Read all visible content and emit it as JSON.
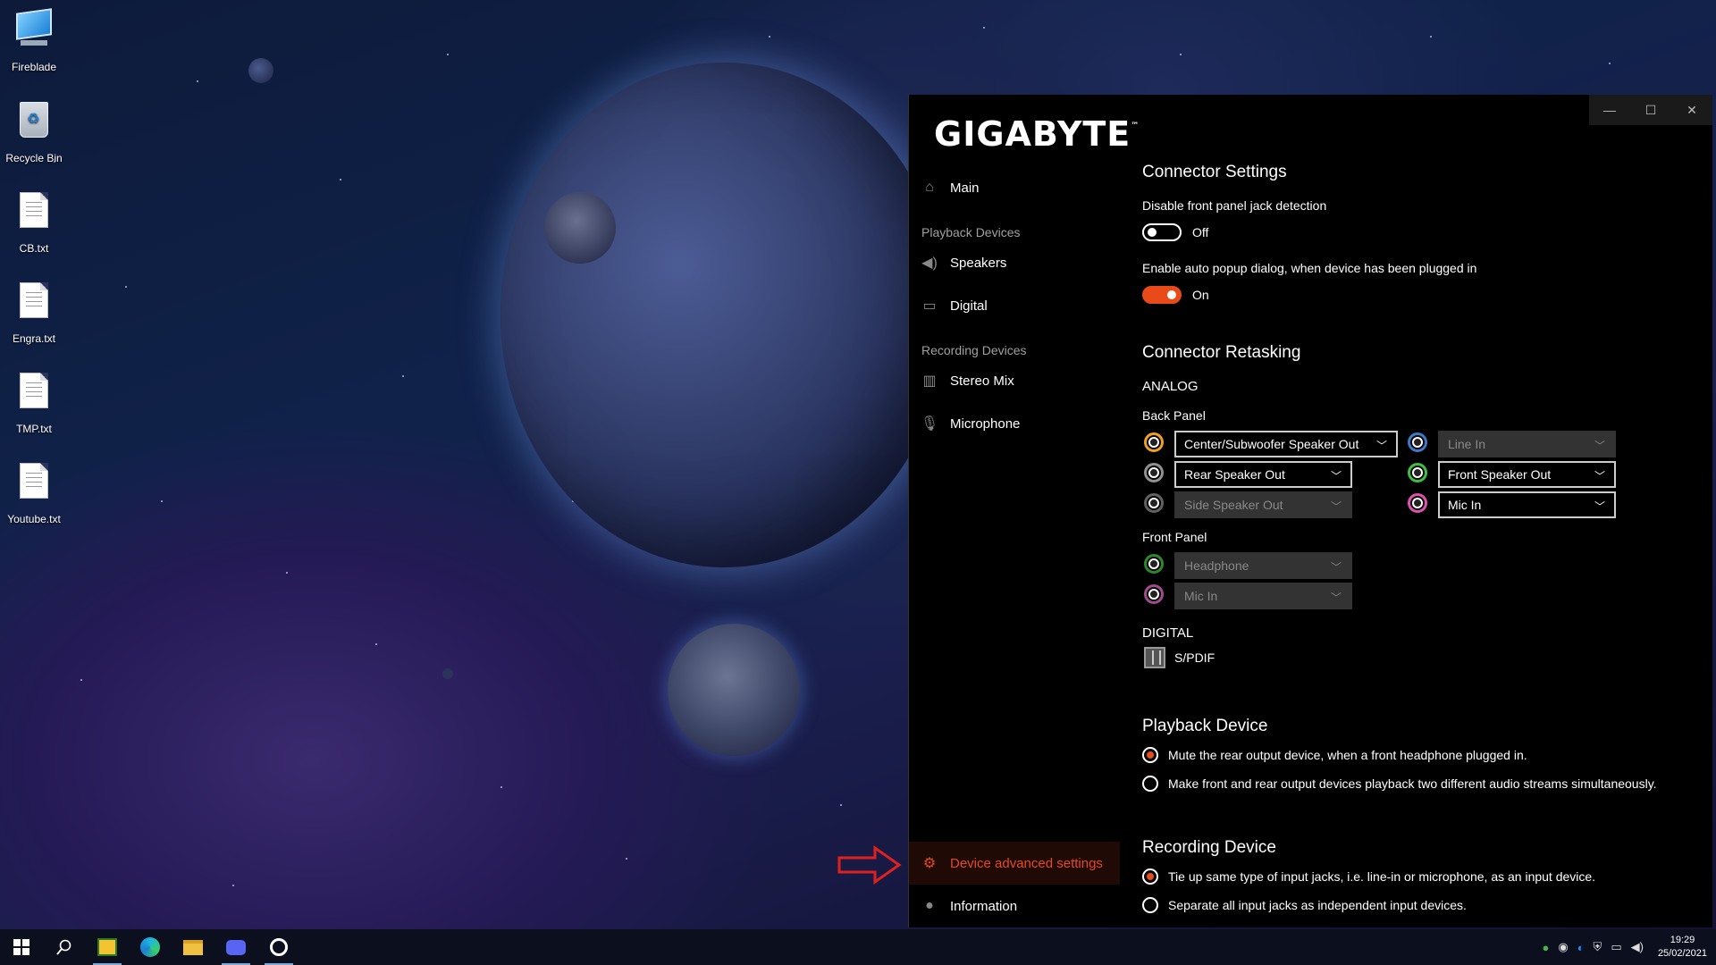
{
  "desktop": {
    "icons": [
      {
        "label": "Fireblade",
        "icon": "computer-icon"
      },
      {
        "label": "Recycle Bin",
        "icon": "recycle-bin-icon"
      },
      {
        "label": "CB.txt",
        "icon": "text-file-icon"
      },
      {
        "label": "Engra.txt",
        "icon": "text-file-icon"
      },
      {
        "label": "TMP.txt",
        "icon": "text-file-icon"
      },
      {
        "label": "Youtube.txt",
        "icon": "text-file-icon"
      }
    ]
  },
  "app": {
    "logo": "GIGABYTE",
    "logo_tm": "™",
    "window_controls": {
      "minimize": "—",
      "maximize": "☐",
      "close": "✕"
    },
    "nav": {
      "main": "Main",
      "playback_section": "Playback Devices",
      "speakers": "Speakers",
      "digital": "Digital",
      "recording_section": "Recording Devices",
      "stereo_mix": "Stereo Mix",
      "microphone": "Microphone",
      "device_advanced": "Device advanced settings",
      "information": "Information"
    },
    "connector_settings": {
      "title": "Connector Settings",
      "disable_front_label": "Disable front panel jack detection",
      "disable_front_state": "Off",
      "auto_popup_label": "Enable auto popup dialog, when device has been plugged in",
      "auto_popup_state": "On"
    },
    "connector_retasking": {
      "title": "Connector Retasking",
      "analog": "ANALOG",
      "back_panel": "Back Panel",
      "back_left": [
        {
          "value": "Center/Subwoofer Speaker Out",
          "jack_color": "#f0a020",
          "disabled": false
        },
        {
          "value": "Rear Speaker Out",
          "jack_color": "#909090",
          "disabled": false
        },
        {
          "value": "Side Speaker Out",
          "jack_color": "#606060",
          "disabled": true
        }
      ],
      "back_right": [
        {
          "value": "Line In",
          "jack_color": "#3a7ac8",
          "disabled": true
        },
        {
          "value": "Front Speaker Out",
          "jack_color": "#3cc040",
          "disabled": false
        },
        {
          "value": "Mic In",
          "jack_color": "#e050b0",
          "disabled": false
        }
      ],
      "front_panel": "Front Panel",
      "front": [
        {
          "value": "Headphone",
          "jack_color": "#2a8a2a",
          "disabled": true
        },
        {
          "value": "Mic In",
          "jack_color": "#a04a90",
          "disabled": true
        }
      ],
      "digital": "DIGITAL",
      "spdif": "S/PDIF"
    },
    "playback_device": {
      "title": "Playback Device",
      "option1": "Mute the rear output device, when a front headphone plugged in.",
      "option2": "Make front and rear output devices playback two different audio streams simultaneously.",
      "selected": 1
    },
    "recording_device": {
      "title": "Recording Device",
      "option1": "Tie up same type of input jacks, i.e. line-in or microphone, as an input device.",
      "option2": "Separate all input jacks as independent input devices.",
      "selected": 1
    }
  },
  "taskbar": {
    "time": "19:29",
    "date": "25/02/2021"
  },
  "colors": {
    "accent": "#e84a1a",
    "annotation_arrow": "#e02020"
  }
}
